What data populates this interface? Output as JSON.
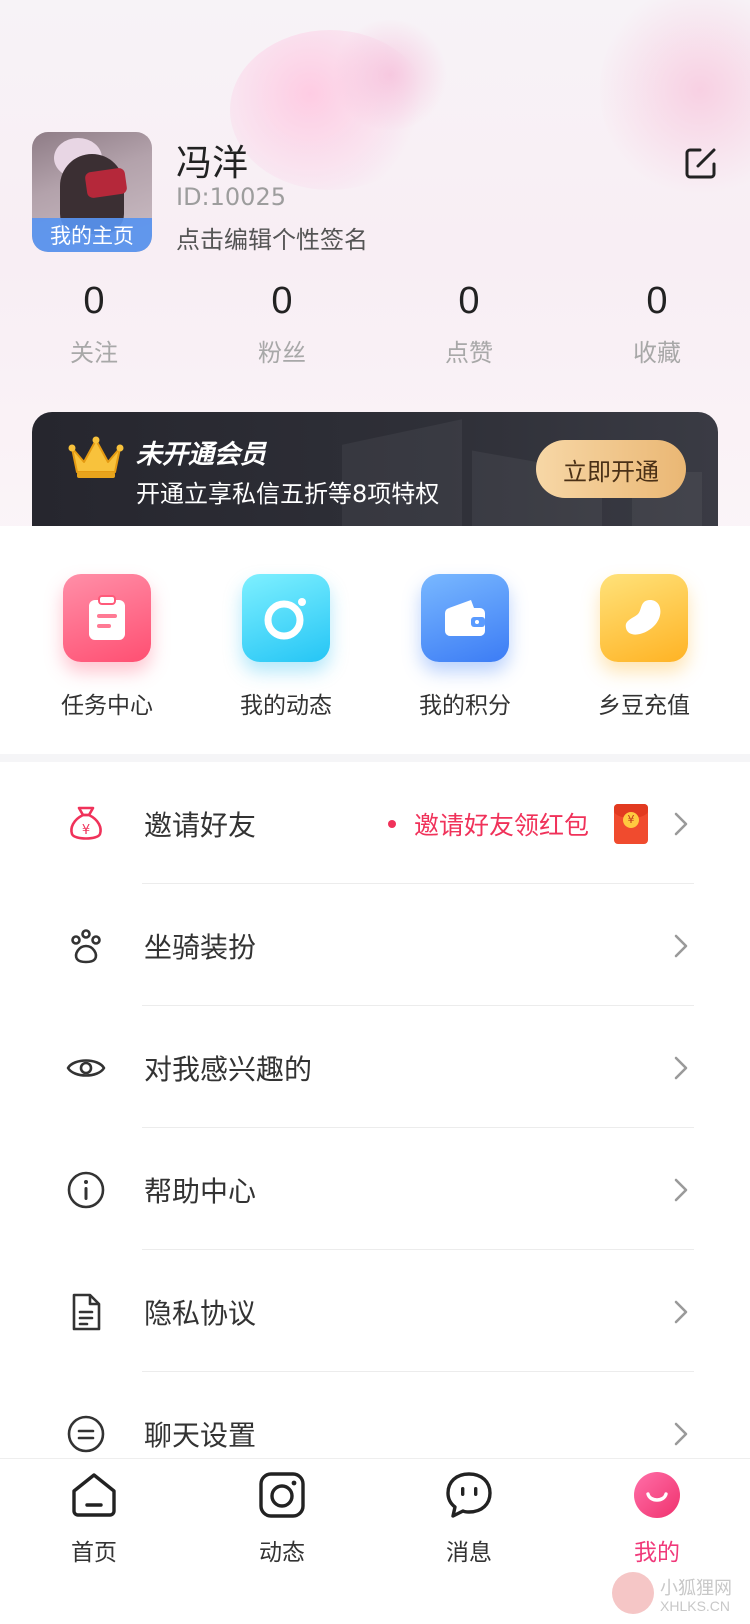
{
  "profile": {
    "name": "冯洋",
    "id_text": "ID:10025",
    "signature": "点击编辑个性签名",
    "home_tag": "我的主页"
  },
  "stats": [
    {
      "value": "0",
      "label": "关注"
    },
    {
      "value": "0",
      "label": "粉丝"
    },
    {
      "value": "0",
      "label": "点赞"
    },
    {
      "value": "0",
      "label": "收藏"
    }
  ],
  "vip": {
    "title": "未开通会员",
    "subtitle": "开通立享私信五折等8项特权",
    "button": "立即开通"
  },
  "quick_actions": [
    {
      "label": "任务中心",
      "icon": "clipboard-icon",
      "color": "#ff5a7a"
    },
    {
      "label": "我的动态",
      "icon": "camera-icon",
      "color": "#25c5f5"
    },
    {
      "label": "我的积分",
      "icon": "wallet-icon",
      "color": "#3c7cf5"
    },
    {
      "label": "乡豆充值",
      "icon": "bean-icon",
      "color": "#ffb324"
    }
  ],
  "menu": [
    {
      "label": "邀请好友",
      "icon": "money-bag-icon",
      "extra": "邀请好友领红包"
    },
    {
      "label": "坐骑装扮",
      "icon": "paw-icon"
    },
    {
      "label": "对我感兴趣的",
      "icon": "eye-icon"
    },
    {
      "label": "帮助中心",
      "icon": "info-icon"
    },
    {
      "label": "隐私协议",
      "icon": "document-icon"
    },
    {
      "label": "聊天设置",
      "icon": "chat-settings-icon"
    }
  ],
  "tabs": [
    {
      "label": "首页",
      "icon": "home-icon"
    },
    {
      "label": "动态",
      "icon": "camera-icon"
    },
    {
      "label": "消息",
      "icon": "message-icon"
    },
    {
      "label": "我的",
      "icon": "profile-smile-icon",
      "active": true
    }
  ],
  "watermark": {
    "line1": "小狐狸网",
    "line2": "XHLKS.CN"
  },
  "colors": {
    "accent": "#f0397a",
    "invite_red": "#f0325a",
    "vip_gold": "#eab774"
  }
}
